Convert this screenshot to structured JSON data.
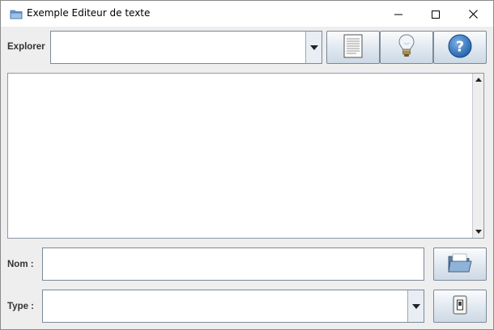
{
  "window": {
    "title": "Exemple Editeur de texte",
    "icons": {
      "app": "folder-icon",
      "minimize": "minimize-icon",
      "maximize": "maximize-icon",
      "close": "close-icon"
    }
  },
  "toolbar": {
    "explorer_label": "Explorer",
    "explorer_value": "",
    "buttons": {
      "new": "document-icon",
      "hint": "lightbulb-icon",
      "help": "help-icon"
    }
  },
  "editor": {
    "text": ""
  },
  "form": {
    "name_label": "Nom :",
    "name_value": "",
    "open_icon": "open-folder-icon",
    "type_label": "Type :",
    "type_value": "",
    "switch_icon": "switch-icon"
  }
}
